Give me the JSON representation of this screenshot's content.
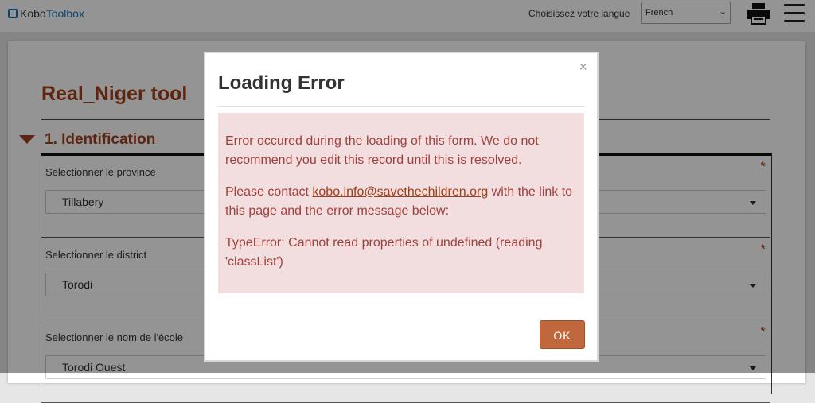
{
  "header": {
    "logo_part1": "Kobo",
    "logo_part2": "Toolbox",
    "language_label": "Choisissez votre langue",
    "language_selected": "French"
  },
  "form": {
    "title": "Real_Niger tool",
    "section_title": "1. Identification",
    "required_marker": "*",
    "questions": [
      {
        "label": "Selectionner le province",
        "value": "Tillabery"
      },
      {
        "label": "Selectionner le district",
        "value": "Torodi"
      },
      {
        "label": "Selectionner le nom de l'école",
        "value": "Torodi Ouest"
      }
    ]
  },
  "modal": {
    "title": "Loading Error",
    "close_symbol": "×",
    "message1": "Error occured during the loading of this form. We do not recommend you edit this record until this is resolved.",
    "message2_prefix": "Please contact ",
    "contact_email": "kobo.info@savethechildren.org",
    "message2_suffix": " with the link to this page and the error message below:",
    "error_text": "TypeError: Cannot read properties of undefined (reading 'classList')",
    "ok_label": "OK"
  },
  "colors": {
    "accent": "#a0401a",
    "alert_bg": "#f2dede",
    "alert_text": "#a0403c",
    "ok_button": "#c0673c"
  }
}
